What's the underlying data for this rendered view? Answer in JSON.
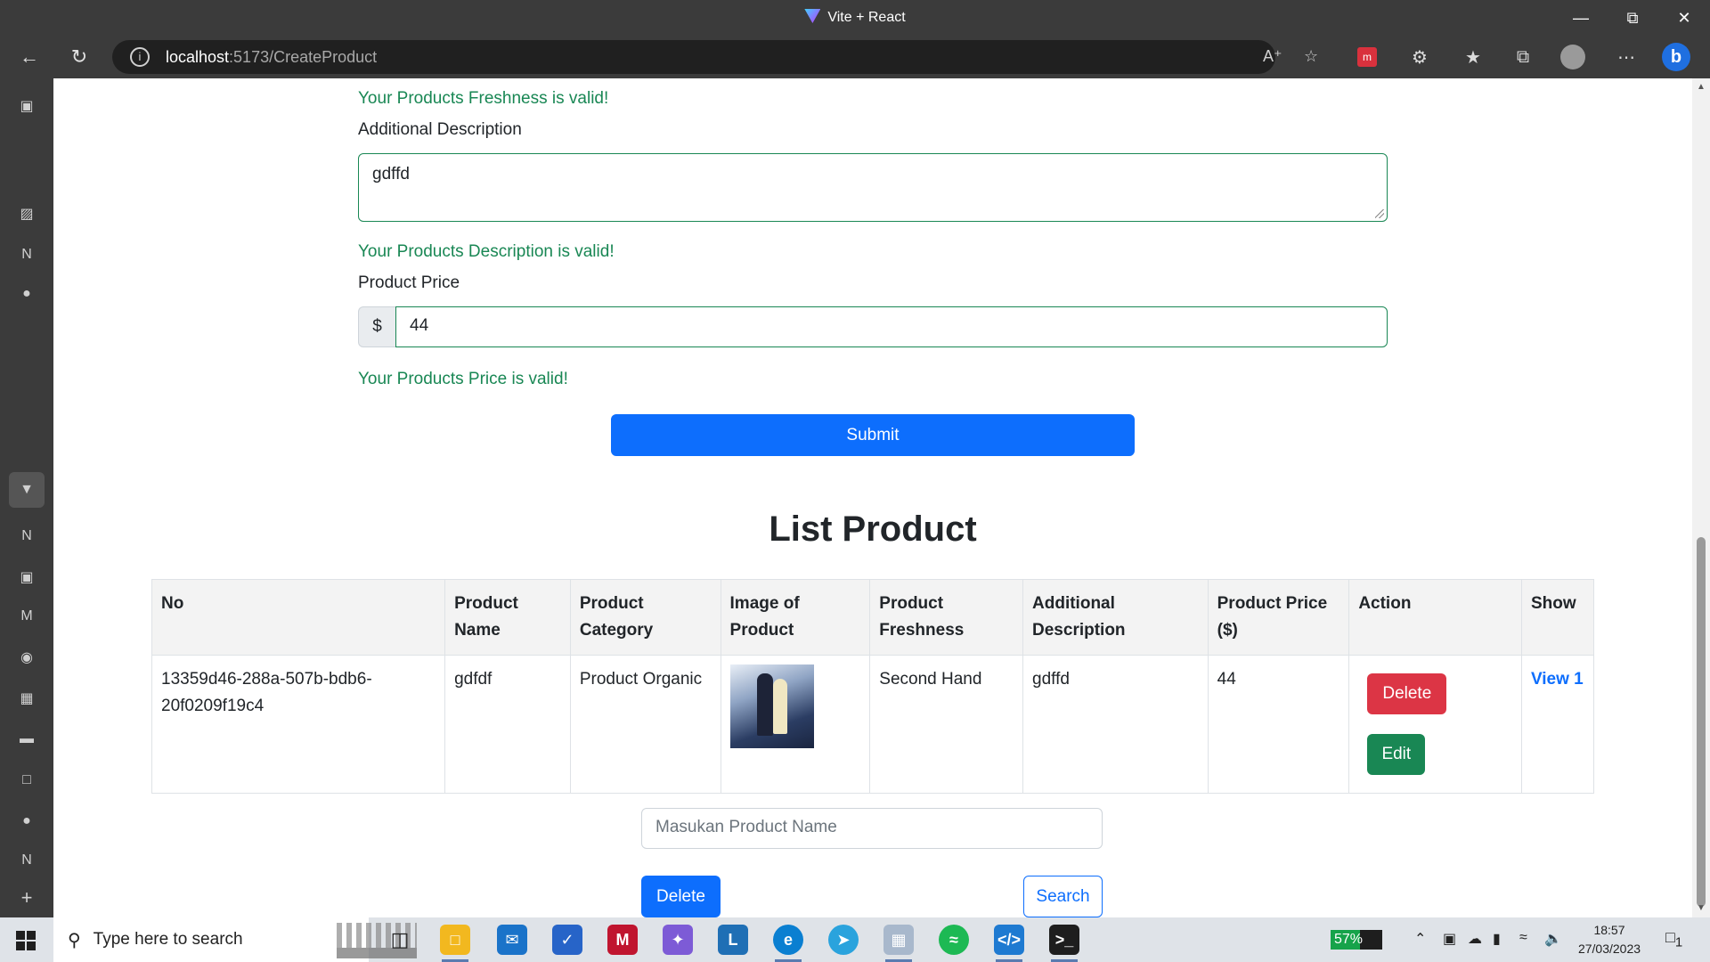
{
  "window": {
    "title": "Vite + React"
  },
  "browser": {
    "url_host": "localhost",
    "url_path": ":5173/CreateProduct",
    "window_controls": [
      "minimize",
      "restore",
      "close"
    ]
  },
  "form": {
    "freshness_valid": "Your Products Freshness is valid!",
    "description_label": "Additional Description",
    "description_value": "gdffd",
    "description_valid": "Your Products Description is valid!",
    "price_label": "Product Price",
    "price_prefix": "$",
    "price_value": "44",
    "price_valid": "Your Products Price is valid!",
    "submit_label": "Submit"
  },
  "list": {
    "heading": "List Product",
    "columns": [
      "No",
      "Product Name",
      "Product Category",
      "Image of Product",
      "Product Freshness",
      "Additional Description",
      "Product Price ($)",
      "Action",
      "Show"
    ],
    "rows": [
      {
        "no": "13359d46-288a-507b-bdb6-20f0209f19c4",
        "name": "gdfdf",
        "category": "Product Organic",
        "freshness": "Second Hand",
        "description": "gdffd",
        "price": "44",
        "delete_label": "Delete",
        "edit_label": "Edit",
        "view_label": "View 1"
      }
    ]
  },
  "search": {
    "placeholder": "Masukan Product Name",
    "delete_label": "Delete",
    "search_label": "Search"
  },
  "taskbar": {
    "search_placeholder": "Type here to search",
    "battery": "57%",
    "time": "18:57",
    "date": "27/03/2023",
    "notification_count": "1"
  },
  "colors": {
    "valid_green": "#198754",
    "primary_blue": "#0d6efd",
    "danger_red": "#dc3545",
    "chrome_dark": "#3b3b3b"
  }
}
